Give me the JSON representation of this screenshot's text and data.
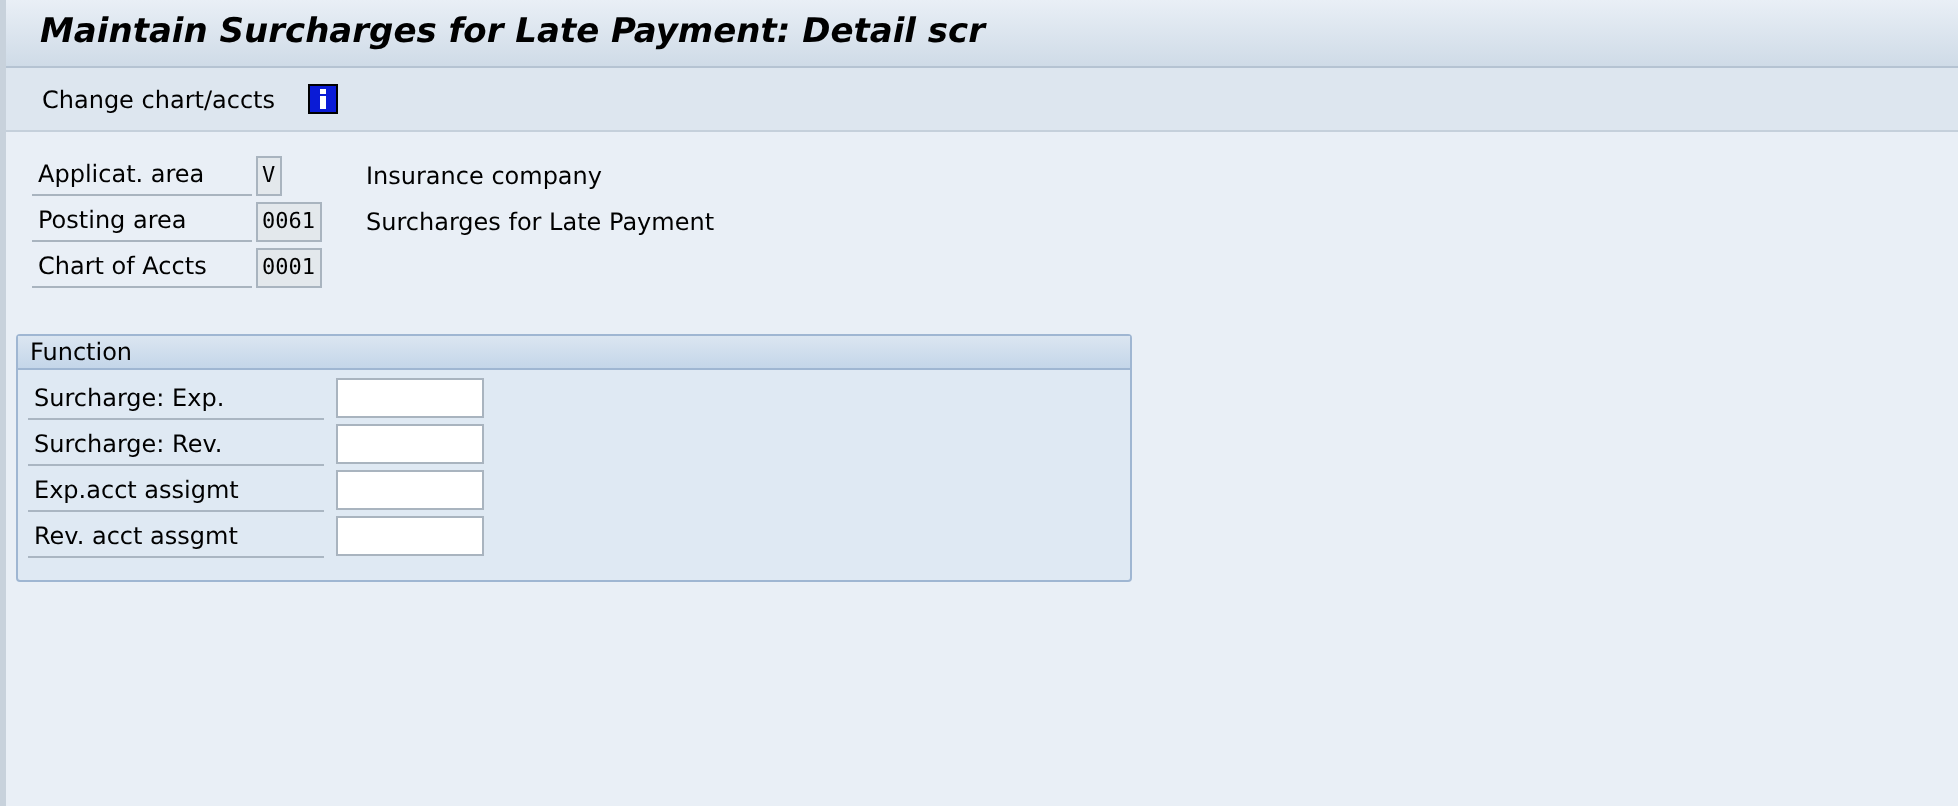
{
  "window": {
    "title": "Maintain Surcharges for Late Payment: Detail scr"
  },
  "toolbar": {
    "buttons": [
      {
        "kind": "text",
        "label": "Change chart/accts"
      },
      {
        "kind": "info"
      }
    ]
  },
  "header_fields": [
    {
      "label": "Applicat. area",
      "value": "V",
      "description": "Insurance company"
    },
    {
      "label": "Posting area",
      "value": "0061",
      "description": "Surcharges for Late Payment"
    },
    {
      "label": "Chart of Accts",
      "value": "0001"
    }
  ],
  "group": {
    "title": "Function",
    "fields": [
      {
        "label": "Surcharge: Exp."
      },
      {
        "label": "Surcharge: Rev."
      },
      {
        "label": "Exp.acct assigmt"
      },
      {
        "label": "Rev. acct assgmt"
      }
    ]
  }
}
